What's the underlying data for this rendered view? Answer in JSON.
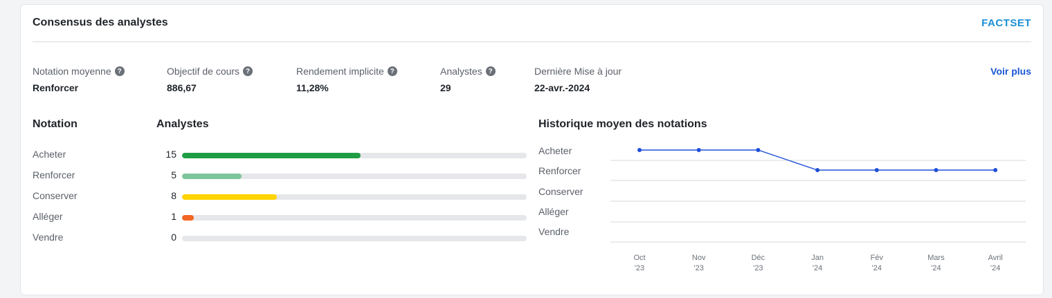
{
  "card": {
    "title": "Consensus des analystes",
    "logo": "FACTSET",
    "voir_plus": "Voir plus"
  },
  "metrics": [
    {
      "label": "Notation moyenne",
      "value": "Renforcer",
      "help": true
    },
    {
      "label": "Objectif de cours",
      "value": "886,67",
      "help": true
    },
    {
      "label": "Rendement implicite",
      "value": "11,28%",
      "help": true
    },
    {
      "label": "Analystes",
      "value": "29",
      "help": true
    },
    {
      "label": "Dernière Mise à jour",
      "value": "22-avr.-2024",
      "help": false
    }
  ],
  "distribution": {
    "heading_rating": "Notation",
    "heading_analysts": "Analystes",
    "max": 29,
    "rows": [
      {
        "label": "Acheter",
        "count": "15",
        "value": 15,
        "color": "#1f9d45"
      },
      {
        "label": "Renforcer",
        "count": "5",
        "value": 5,
        "color": "#7dc59a"
      },
      {
        "label": "Conserver",
        "count": "8",
        "value": 8,
        "color": "#ffd400"
      },
      {
        "label": "Alléger",
        "count": "1",
        "value": 1,
        "color": "#f26522"
      },
      {
        "label": "Vendre",
        "count": "0",
        "value": 0,
        "color": "#d32f2f"
      }
    ]
  },
  "history": {
    "heading": "Historique moyen des notations",
    "levels": [
      "Acheter",
      "Renforcer",
      "Conserver",
      "Alléger",
      "Vendre"
    ]
  },
  "chart_data": {
    "type": "line",
    "title": "Historique moyen des notations",
    "x": [
      [
        "Oct",
        "'23"
      ],
      [
        "Nov",
        "'23"
      ],
      [
        "Déc",
        "'23"
      ],
      [
        "Jan",
        "'24"
      ],
      [
        "Fév",
        "'24"
      ],
      [
        "Mars",
        "'24"
      ],
      [
        "Avril",
        "'24"
      ]
    ],
    "y_categories": [
      "Acheter",
      "Renforcer",
      "Conserver",
      "Alléger",
      "Vendre"
    ],
    "values": [
      "Acheter",
      "Acheter",
      "Acheter",
      "Renforcer",
      "Renforcer",
      "Renforcer",
      "Renforcer"
    ],
    "line_color": "#1e4fd8",
    "grid": true
  }
}
